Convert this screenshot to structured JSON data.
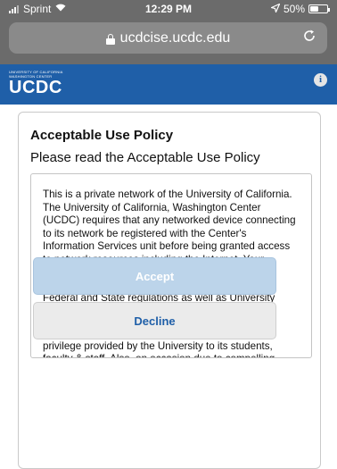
{
  "status_bar": {
    "carrier": "Sprint",
    "time": "12:29 PM",
    "battery_text": "50%",
    "battery_level": 0.5
  },
  "browser": {
    "url": "ucdcise.ucdc.edu"
  },
  "site_header": {
    "logo_line1": "UNIVERSITY OF CALIFORNIA",
    "logo_line2": "WASHINGTON CENTER",
    "logo_text": "UCDC",
    "info_icon": "i",
    "color": "#1f5fa8"
  },
  "policy": {
    "title": "Acceptable Use Policy",
    "subtitle": "Please read the Acceptable Use Policy",
    "paragraphs": [
      "This is a private network of the University of California. The University of California, Washington Center (UCDC) requires that any networked device connecting to its network be registered with the Center's Information Services unit before being granted access to network resources including the Internet. Your registration helps protect the integrity of the UCDC network and assists the Center in complying with Federal and State regulations as well as University policies.",
      "Access to network and other network services is a privilege provided by the University to its students, faculty & staff. Also, on occasion due to compelling"
    ]
  },
  "buttons": {
    "accept_label": "Accept",
    "decline_label": "Decline"
  }
}
